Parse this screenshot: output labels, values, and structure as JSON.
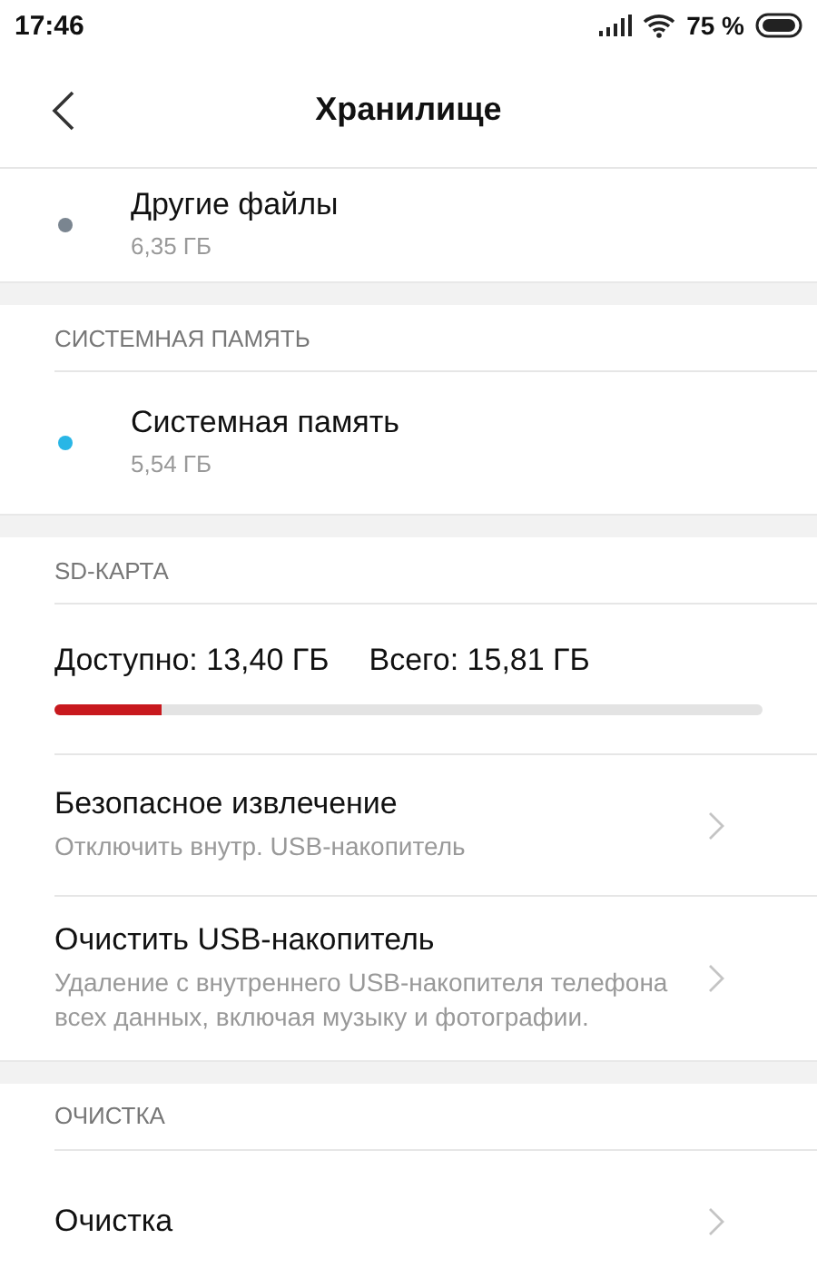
{
  "status_bar": {
    "time": "17:46",
    "battery": "75 %"
  },
  "header": {
    "title": "Хранилище"
  },
  "sections": [
    {
      "items": [
        {
          "kind": "storage",
          "name": "Другие файлы",
          "size": "6,35 ГБ",
          "color": "#7a8590"
        }
      ]
    },
    {
      "title": "СИСТЕМНАЯ ПАМЯТЬ",
      "items": [
        {
          "kind": "storage",
          "name": "Системная память",
          "size": "5,54 ГБ",
          "color": "#29b6e6"
        }
      ]
    },
    {
      "title": "SD-КАРТА",
      "items": [
        {
          "kind": "usage",
          "available": "Доступно: 13,40 ГБ",
          "total": "Всего: 15,81 ГБ",
          "level": 0.15
        },
        {
          "kind": "action",
          "title": "Безопасное извлечение",
          "subtitle": "Отключить внутр. USB-накопитель"
        },
        {
          "kind": "action",
          "title": "Очистить USB-накопитель",
          "subtitle": "Удаление с внутреннего USB-накопителя телефона всех данных, включая музыку и фотографии."
        }
      ]
    },
    {
      "title": "ОЧИСТКА",
      "items": [
        {
          "kind": "action",
          "title": "Очистка"
        }
      ]
    }
  ]
}
